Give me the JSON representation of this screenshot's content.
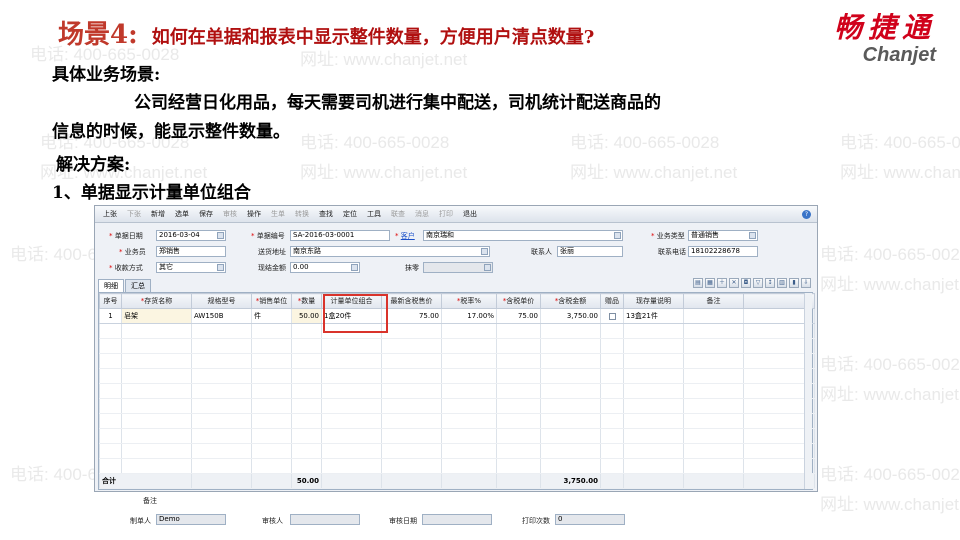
{
  "slide": {
    "title_prefix": "场景4:",
    "title_question": "如何在单据和报表中显示整件数量，方便用户清点数量?",
    "logo_cn": "畅捷通",
    "logo_en": "Chanjet",
    "biz_heading": "具体业务场景:",
    "biz_line1": "公司经营日化用品，每天需要司机进行集中配送，司机统计配送商品的",
    "biz_line2": "信息的时候，能显示整件数量。",
    "solution_heading": "解决方案:",
    "solution_item": "1、单据显示计量单位组合"
  },
  "watermark": {
    "phone": "电话: 400-665-0028",
    "site": "网址: www.chanjet.net"
  },
  "toolbar": {
    "items": [
      "上张",
      "下张",
      "新增",
      "选单",
      "保存",
      "审核",
      "操作",
      "生单",
      "转换",
      "查找",
      "定位",
      "工具",
      "联查",
      "消息",
      "打印",
      "退出"
    ],
    "help": "?"
  },
  "form": {
    "date_label": "单据日期",
    "date_value": "2016-03-04",
    "code_label": "单据编号",
    "code_value": "SA-2016-03-0001",
    "customer_label": "客户",
    "customer_value": "南京瑞和",
    "biztype_label": "业务类型",
    "biztype_value": "普通销售",
    "salesman_label": "业务员",
    "salesman_value": "郑销售",
    "address_label": "送货地址",
    "address_value": "南京东路",
    "contact_label": "联系人",
    "contact_value": "张丽",
    "phone_label": "联系电话",
    "phone_value": "18102228678",
    "payment_label": "收款方式",
    "payment_value": "其它",
    "cash_label": "现结金额",
    "cash_value": "0.00",
    "round_label": "抹零",
    "round_value": ""
  },
  "tabs": [
    "明细",
    "汇总"
  ],
  "grid": {
    "headers": [
      "序号",
      "存货名称",
      "规格型号",
      "销售单位",
      "数量",
      "计量单位组合",
      "最新含税售价",
      "税率%",
      "含税单价",
      "含税金额",
      "赠品",
      "现存量说明",
      "备注"
    ],
    "rows": [
      {
        "no": "1",
        "name": "皂架",
        "spec": "AW150B",
        "unit": "件",
        "qty": "50.00",
        "combo": "1盒20件",
        "latest_price": "75.00",
        "tax_rate": "17.00%",
        "unit_price": "75.00",
        "amount": "3,750.00",
        "stock": "13盒21件",
        "note": ""
      }
    ],
    "total_label": "合计",
    "total_qty": "50.00",
    "total_amount": "3,750.00"
  },
  "footer": {
    "note_label": "备注",
    "maker_label": "制单人",
    "maker_value": "Demo",
    "auditor_label": "审核人",
    "auditor_value": "",
    "audit_date_label": "审核日期",
    "audit_date_value": "",
    "print_label": "打印次数",
    "print_value": "0"
  }
}
